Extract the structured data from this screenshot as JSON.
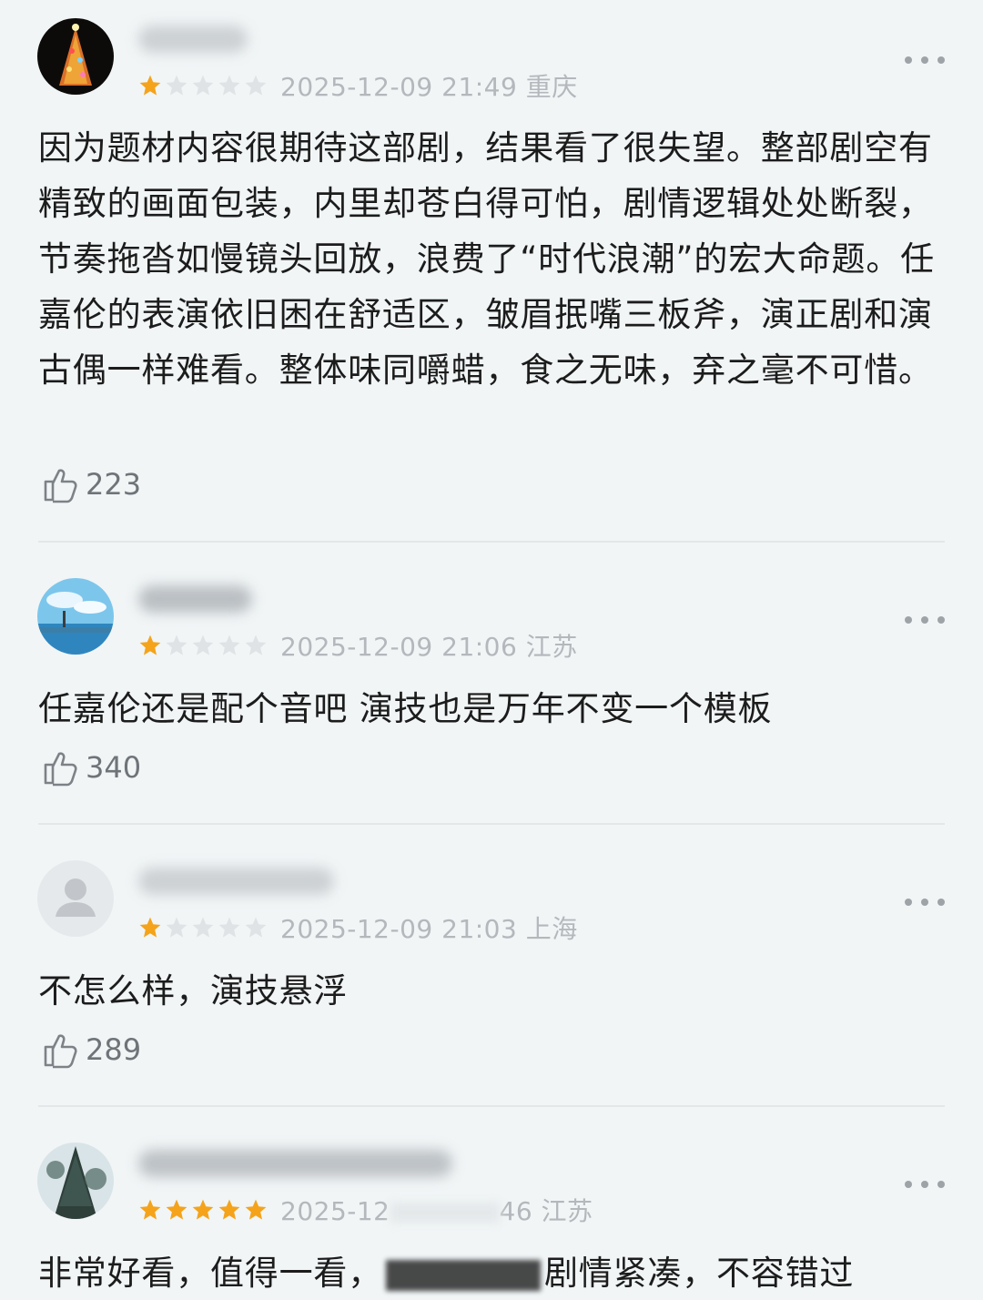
{
  "reviews": [
    {
      "rating": 1,
      "datetime": "2025-12-09 21:49",
      "location": "重庆",
      "text": "因为题材内容很期待这部剧，结果看了很失望。整部剧空有精致的画面包装，内里却苍白得可怕，剧情逻辑处处断裂，节奏拖沓如慢镜头回放，浪费了“时代浪潮”的宏大命题。任嘉伦的表演依旧困在舒适区，皱眉抿嘴三板斧，演正剧和演古偶一样难看。整体味同嚼蜡，食之无味，弃之毫不可惜。",
      "likes": "223"
    },
    {
      "rating": 1,
      "datetime": "2025-12-09 21:06",
      "location": "江苏",
      "text": "任嘉伦还是配个音吧 演技也是万年不变一个模板",
      "likes": "340"
    },
    {
      "rating": 1,
      "datetime": "2025-12-09 21:03",
      "location": "上海",
      "text": "不怎么样，演技悬浮",
      "likes": "289"
    },
    {
      "rating": 5,
      "datetime": "2025-12",
      "time_tail": "46",
      "location": "江苏",
      "text": "非常好看，值得一看，",
      "text_tail": "剧情紧凑，不容错过"
    }
  ],
  "colors": {
    "star_filled": "#f5a31a",
    "star_empty": "#dfe3e6",
    "background": "#f1f5f6"
  }
}
